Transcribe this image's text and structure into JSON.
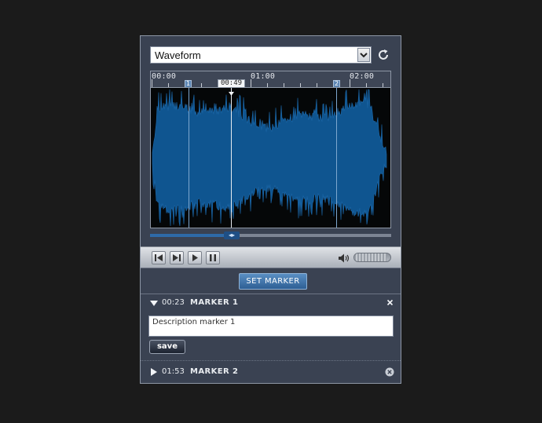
{
  "view_select": {
    "value": "Waveform"
  },
  "timeline": {
    "labels": [
      "00:00",
      "01:00",
      "02:00"
    ],
    "playhead_time": "00:49",
    "marker_flags": [
      "1",
      "2"
    ]
  },
  "scroll": {
    "position_fraction": 0.33
  },
  "transport": {
    "buttons": [
      "skip-to-start",
      "skip-to-end",
      "play",
      "pause"
    ],
    "volume_fraction": 0.9
  },
  "set_marker_label": "SET MARKER",
  "markers": [
    {
      "time": "00:23",
      "name": "MARKER 1",
      "description": "Description marker 1",
      "save_label": "save",
      "expanded": true
    },
    {
      "time": "01:53",
      "name": "MARKER 2",
      "expanded": false
    }
  ],
  "colors": {
    "waveform": "#0f5590",
    "background": "#1b1b1b",
    "panel": "#3a4252",
    "accent": "#2e6aa8"
  }
}
